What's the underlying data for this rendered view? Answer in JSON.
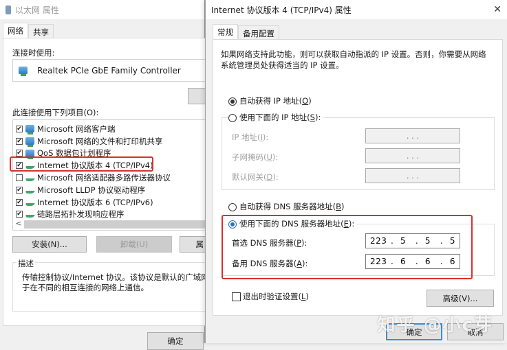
{
  "left_window": {
    "title": "以太网 属性",
    "tabs": [
      {
        "label": "网络",
        "active": true
      },
      {
        "label": "共享",
        "active": false
      }
    ],
    "connect_using_label": "连接时使用:",
    "adapter_name": "Realtek PCIe GbE Family Controller",
    "items_label": "此连接使用下列项目(O):",
    "items": [
      {
        "label": "Microsoft 网络客户端",
        "checked": true,
        "icon": "network-client-icon"
      },
      {
        "label": "Microsoft 网络的文件和打印机共享",
        "checked": true,
        "icon": "file-share-icon"
      },
      {
        "label": "QoS 数据包计划程序",
        "checked": true,
        "icon": "qos-icon"
      },
      {
        "label": "Internet 协议版本 4 (TCP/IPv4)",
        "checked": true,
        "icon": "protocol-icon",
        "highlighted": true
      },
      {
        "label": "Microsoft 网络适配器多路传送器协议",
        "checked": false,
        "icon": "protocol-icon"
      },
      {
        "label": "Microsoft LLDP 协议驱动程序",
        "checked": true,
        "icon": "protocol-icon"
      },
      {
        "label": "Internet 协议版本 6 (TCP/IPv6)",
        "checked": true,
        "icon": "protocol-icon"
      },
      {
        "label": "链路层拓扑发现响应程序",
        "checked": true,
        "icon": "protocol-icon"
      }
    ],
    "scroll_left": "<",
    "install_button": "安装(N)...",
    "uninstall_button": "卸载(U)",
    "properties_button_partial": "属",
    "description_label": "描述",
    "description_text_1": "传输控制协议/Internet 协议。该协议是默认的广域网络",
    "description_text_2": "于在不同的相互连接的网络上通信。",
    "ok_button": "确定"
  },
  "right_window": {
    "title": "Internet 协议版本 4 (TCP/IPv4) 属性",
    "close_glyph": "✕",
    "tabs": [
      {
        "label": "常规",
        "active": true
      },
      {
        "label": "备用配置",
        "active": false
      }
    ],
    "intro_1": "如果网络支持此功能，则可以获取自动指派的 IP 设置。否则，你需要从网络",
    "intro_2": "系统管理员处获得适当的 IP 设置。",
    "auto_ip": {
      "label": "自动获得 IP 地址(",
      "key": "O",
      "suffix": ")",
      "selected": true
    },
    "manual_ip": {
      "label": "使用下面的 IP 地址(",
      "key": "S",
      "suffix": "):",
      "selected": false
    },
    "ip_fields": [
      {
        "label": "IP 地址(",
        "key": "I",
        "suffix": "):",
        "value": ". . ."
      },
      {
        "label": "子网掩码(",
        "key": "U",
        "suffix": "):",
        "value": ". . ."
      },
      {
        "label": "默认网关(",
        "key": "D",
        "suffix": "):",
        "value": ". . ."
      }
    ],
    "auto_dns": {
      "label": "自动获得 DNS 服务器地址(",
      "key": "B",
      "suffix": ")",
      "selected": false
    },
    "manual_dns": {
      "label": "使用下面的 DNS 服务器地址(",
      "key": "E",
      "suffix": "):",
      "selected": true
    },
    "dns_fields": [
      {
        "label": "首选 DNS 服务器(",
        "key": "P",
        "suffix": "):",
        "octets": [
          "223",
          "5",
          "5",
          "5"
        ]
      },
      {
        "label": "备用 DNS 服务器(",
        "key": "A",
        "suffix": "):",
        "octets": [
          "223",
          "6",
          "6",
          "6"
        ]
      }
    ],
    "validate_checkbox": {
      "label": "退出时验证设置(",
      "key": "L",
      "suffix": ")",
      "checked": false
    },
    "advanced_button": "高级(V)...",
    "ok_button": "确定",
    "cancel_button": "取消"
  },
  "watermark": "知乎 @小c芽",
  "colors": {
    "highlight_red": "#d9302a",
    "accent_blue": "#2a6fc2"
  }
}
